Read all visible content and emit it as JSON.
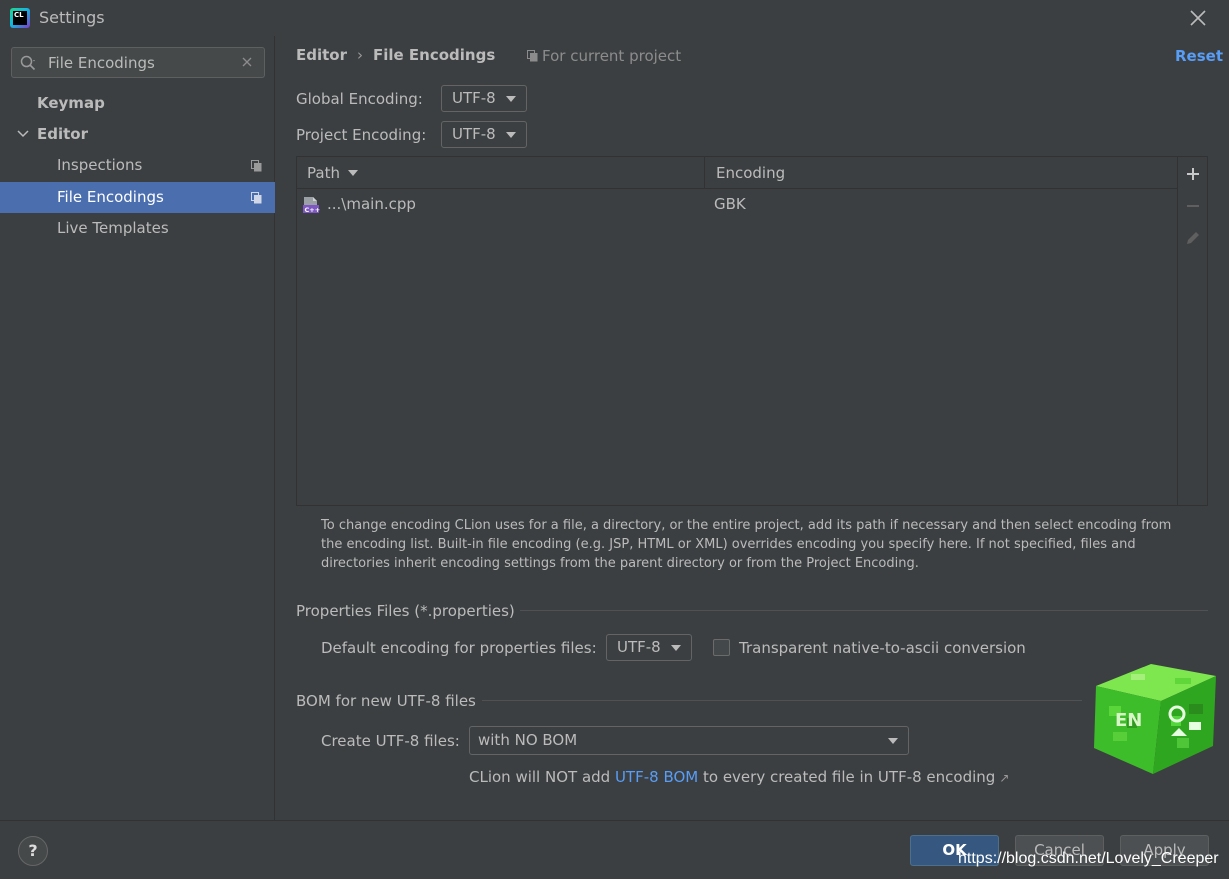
{
  "window": {
    "title": "Settings",
    "app_icon_text": "CL"
  },
  "search": {
    "value": "File Encodings",
    "placeholder": ""
  },
  "sidebar": {
    "items": [
      {
        "label": "Keymap"
      },
      {
        "label": "Editor"
      },
      {
        "label": "Inspections"
      },
      {
        "label": "File Encodings"
      },
      {
        "label": "Live Templates"
      }
    ]
  },
  "header": {
    "breadcrumb_parent": "Editor",
    "breadcrumb_separator": "›",
    "breadcrumb_current": "File Encodings",
    "scope": "For current project",
    "reset_label": "Reset"
  },
  "encodings": {
    "global_label": "Global Encoding:",
    "global_value": "UTF-8",
    "project_label": "Project Encoding:",
    "project_value": "UTF-8"
  },
  "table": {
    "columns": [
      "Path",
      "Encoding"
    ],
    "rows": [
      {
        "path": "...\\main.cpp",
        "encoding": "GBK"
      }
    ]
  },
  "help_text": "To change encoding CLion uses for a file, a directory, or the entire project, add its path if necessary and then select encoding from the encoding list. Built-in file encoding (e.g. JSP, HTML or XML) overrides encoding you specify here. If not specified, files and directories inherit encoding settings from the parent directory or from the Project Encoding.",
  "properties": {
    "section_title": "Properties Files (*.properties)",
    "default_label": "Default encoding for properties files:",
    "default_value": "UTF-8",
    "native_ascii_label": "Transparent native-to-ascii conversion"
  },
  "bom": {
    "section_title": "BOM for new UTF-8 files",
    "create_label": "Create UTF-8 files:",
    "create_value": "with NO BOM",
    "note_prefix": "CLion will NOT add ",
    "note_link": "UTF-8 BOM",
    "note_suffix": " to every created file in UTF-8 encoding",
    "note_ext": "↗"
  },
  "cube_text": "EN",
  "footer": {
    "help": "?",
    "ok": "OK",
    "cancel": "Cancel",
    "apply": "Apply",
    "watermark": "https://blog.csdn.net/Lovely_Creeper"
  },
  "colors": {
    "accent": "#589df6",
    "selection": "#4b6eaf",
    "primary_button": "#365880"
  }
}
